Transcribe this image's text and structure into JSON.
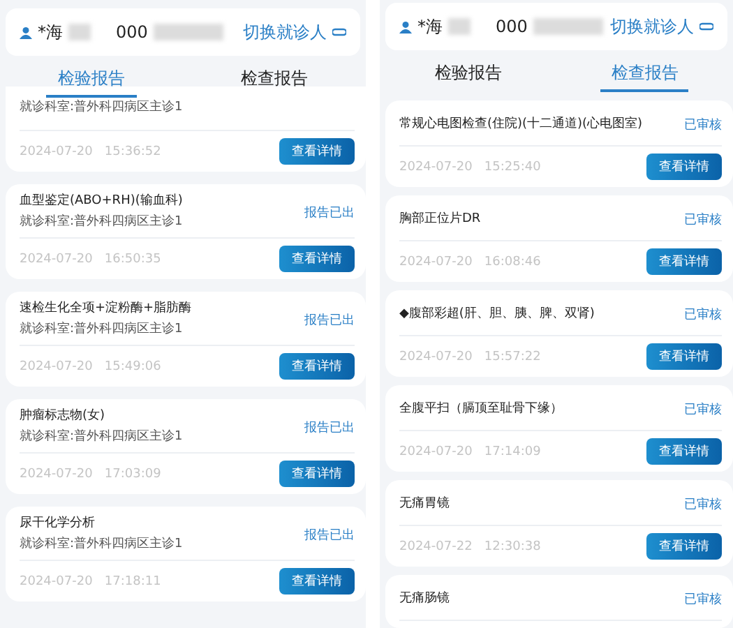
{
  "panels": [
    {
      "patient": {
        "name": "*海",
        "id": "000",
        "switch_label": "切换就诊人"
      },
      "tabs": [
        {
          "label": "检验报告",
          "selected": true
        },
        {
          "label": "检查报告",
          "selected": false
        }
      ],
      "reports": [
        {
          "dept": "就诊科室:普外科四病区主诊1",
          "time": "2024-07-20   15:36:52",
          "button": "查看详情"
        },
        {
          "title": "血型鉴定(ABO+RH)(输血科)",
          "dept": "就诊科室:普外科四病区主诊1",
          "status": "报告已出",
          "time": "2024-07-20   16:50:35",
          "button": "查看详情"
        },
        {
          "title": "速检生化全项+淀粉酶+脂肪酶",
          "dept": "就诊科室:普外科四病区主诊1",
          "status": "报告已出",
          "time": "2024-07-20   15:49:06",
          "button": "查看详情"
        },
        {
          "title": "肿瘤标志物(女)",
          "dept": "就诊科室:普外科四病区主诊1",
          "status": "报告已出",
          "time": "2024-07-20   17:03:09",
          "button": "查看详情"
        },
        {
          "title": "尿干化学分析",
          "dept": "就诊科室:普外科四病区主诊1",
          "status": "报告已出",
          "time": "2024-07-20   17:18:11",
          "button": "查看详情"
        }
      ]
    },
    {
      "patient": {
        "name": "*海",
        "id": "000",
        "switch_label": "切换就诊人"
      },
      "tabs": [
        {
          "label": "检验报告",
          "selected": false
        },
        {
          "label": "检查报告",
          "selected": true
        }
      ],
      "reports": [
        {
          "title": "常规心电图检查(住院)(十二通道)(心电图室)",
          "status": "已审核",
          "time": "2024-07-20   15:25:40",
          "button": "查看详情"
        },
        {
          "title": "胸部正位片DR",
          "status": "已审核",
          "time": "2024-07-20   16:08:46",
          "button": "查看详情"
        },
        {
          "title": "◆腹部彩超(肝、胆、胰、脾、双肾)",
          "status": "已审核",
          "time": "2024-07-20   15:57:22",
          "button": "查看详情"
        },
        {
          "title": "全腹平扫（膈顶至耻骨下缘）",
          "status": "已审核",
          "time": "2024-07-20   17:14:09",
          "button": "查看详情"
        },
        {
          "title": "无痛胃镜",
          "status": "已审核",
          "time": "2024-07-22   12:30:38",
          "button": "查看详情"
        },
        {
          "title": "无痛肠镜",
          "status": "已审核"
        }
      ]
    }
  ]
}
